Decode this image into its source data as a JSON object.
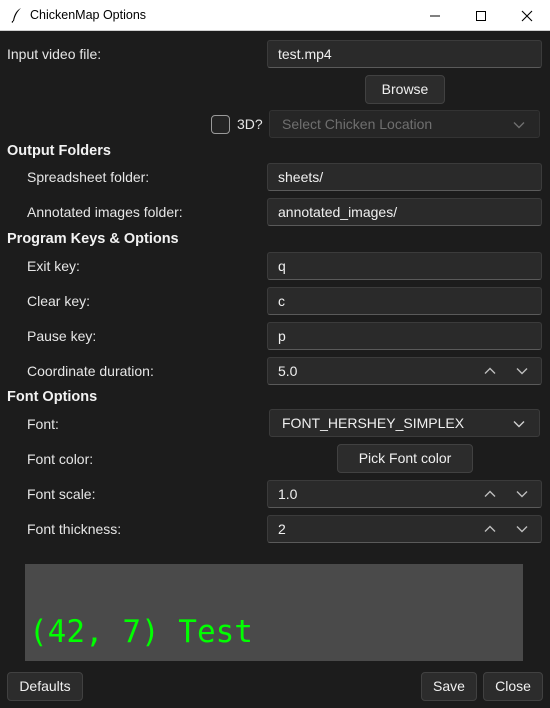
{
  "window": {
    "title": "ChickenMap Options",
    "controls": [
      "minimize-icon",
      "maximize-icon",
      "close-icon"
    ]
  },
  "input": {
    "label": "Input video file:",
    "value": "test.mp4",
    "browse_label": "Browse",
    "checkbox_label": "3D?",
    "checkbox_checked": false,
    "location_placeholder": "Select Chicken Location"
  },
  "output": {
    "section": "Output Folders",
    "spreadsheet_label": "Spreadsheet folder:",
    "spreadsheet_value": "sheets/",
    "annotated_label": "Annotated images folder:",
    "annotated_value": "annotated_images/"
  },
  "keys": {
    "section": "Program Keys & Options",
    "exit_label": "Exit key:",
    "exit_value": "q",
    "clear_label": "Clear key:",
    "clear_value": "c",
    "pause_label": "Pause key:",
    "pause_value": "p",
    "duration_label": "Coordinate duration:",
    "duration_value": "5.0"
  },
  "font": {
    "section": "Font Options",
    "font_label": "Font:",
    "font_value": "FONT_HERSHEY_SIMPLEX",
    "color_label": "Font color:",
    "color_button": "Pick Font color",
    "scale_label": "Font scale:",
    "scale_value": "1.0",
    "thickness_label": "Font thickness:",
    "thickness_value": "2"
  },
  "preview": {
    "text": "(42, 7) Test",
    "text_color": "#00ff00",
    "background": "#4a4a4a"
  },
  "footer": {
    "defaults": "Defaults",
    "save": "Save",
    "close": "Close"
  },
  "colors": {
    "window_bg": "#1c1c1c",
    "field_bg": "#2a2a2a",
    "titlebar_bg": "#ffffff"
  }
}
